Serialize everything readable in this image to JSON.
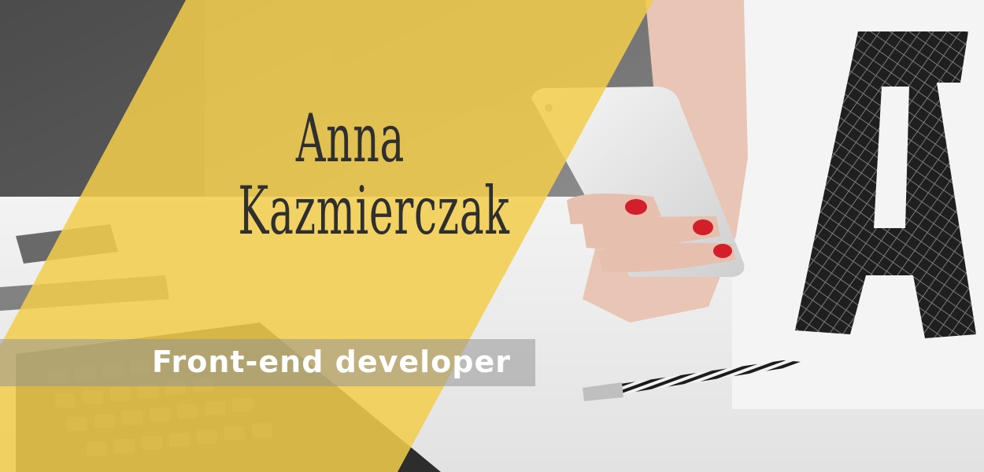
{
  "hero": {
    "name_first": "Anna",
    "name_last": "Kazmierczak",
    "role": "Front-end developer"
  },
  "colors": {
    "accent_yellow": "#f2cd4b",
    "text_dark": "#2f2f2f",
    "text_light": "#ffffff"
  }
}
